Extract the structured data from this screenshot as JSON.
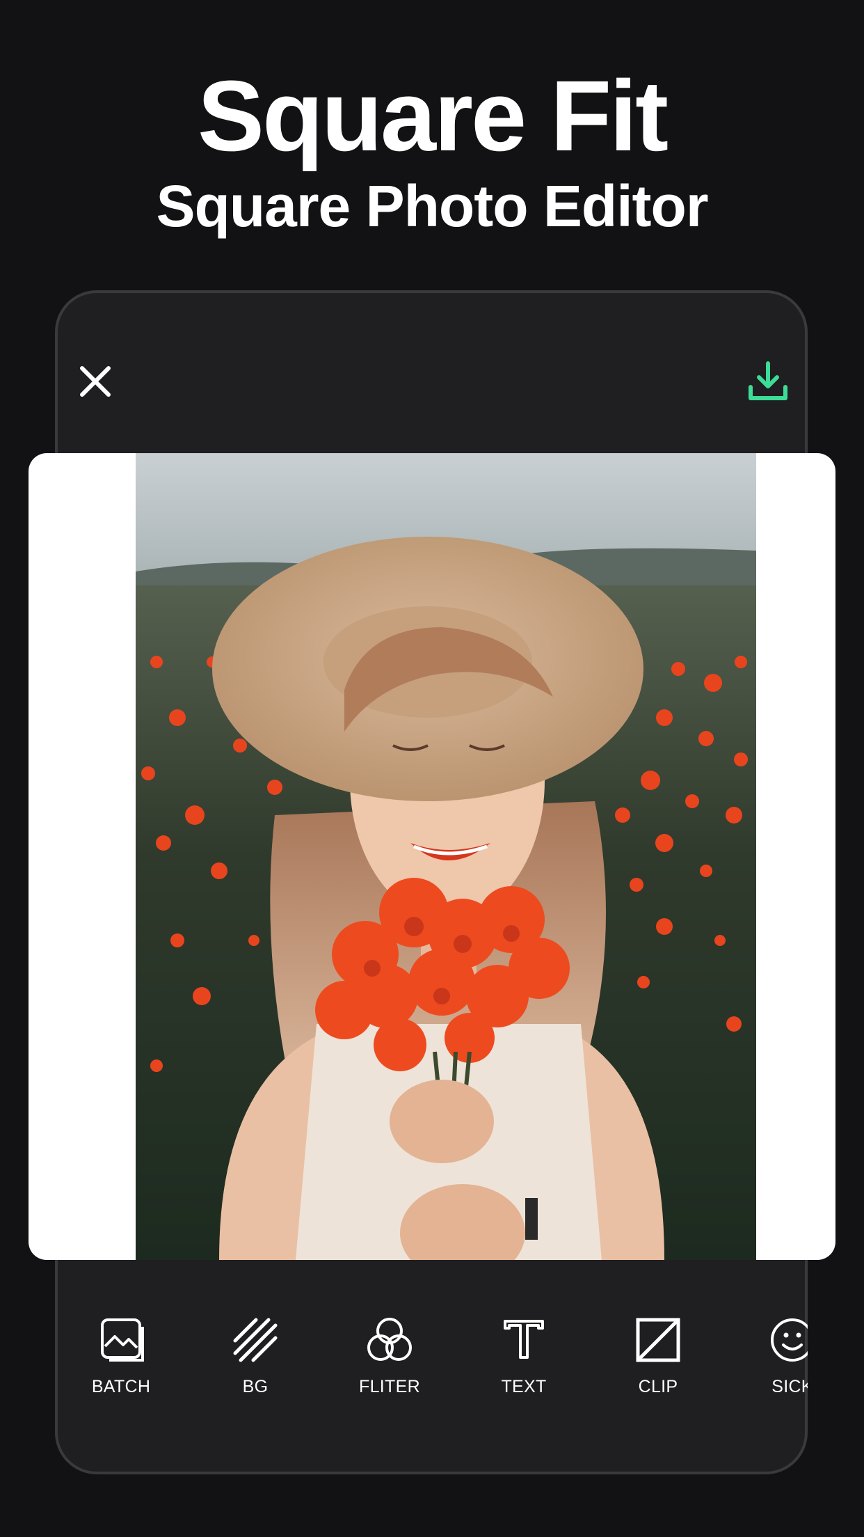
{
  "header": {
    "title": "Square Fit",
    "subtitle": "Square Photo Editor"
  },
  "editor": {
    "close_icon": "close-icon",
    "download_icon": "download-icon",
    "accent_color": "#3ddc97"
  },
  "tools": [
    {
      "label": "BATCH",
      "icon": "batch-icon"
    },
    {
      "label": "BG",
      "icon": "bg-icon"
    },
    {
      "label": "FLITER",
      "icon": "filter-icon"
    },
    {
      "label": "TEXT",
      "icon": "text-icon"
    },
    {
      "label": "CLIP",
      "icon": "clip-icon"
    },
    {
      "label": "SICK",
      "icon": "sticker-icon"
    }
  ]
}
